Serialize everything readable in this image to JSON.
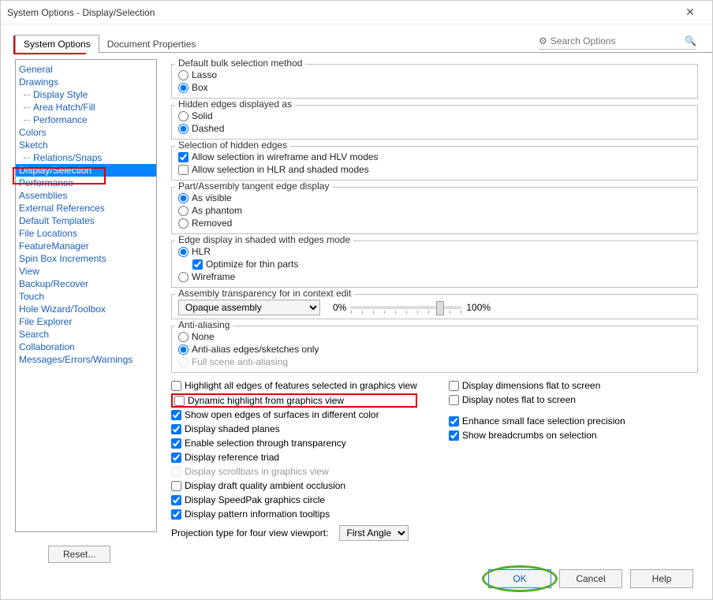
{
  "window": {
    "title": "System Options - Display/Selection"
  },
  "search": {
    "placeholder": "Search Options"
  },
  "tabs": {
    "system": "System Options",
    "document": "Document Properties"
  },
  "tree": [
    "General",
    "Drawings",
    "Display Style",
    "Area Hatch/Fill",
    "Performance",
    "Colors",
    "Sketch",
    "Relations/Snaps",
    "Display/Selection",
    "Performance",
    "Assemblies",
    "External References",
    "Default Templates",
    "File Locations",
    "FeatureManager",
    "Spin Box Increments",
    "View",
    "Backup/Recover",
    "Touch",
    "Hole Wizard/Toolbox",
    "File Explorer",
    "Search",
    "Collaboration",
    "Messages/Errors/Warnings"
  ],
  "tree_meta": {
    "indent_idx": [
      2,
      3,
      4,
      7
    ],
    "selected_idx": 8
  },
  "groups": {
    "bulk": {
      "title": "Default bulk selection method",
      "lasso": "Lasso",
      "box": "Box"
    },
    "hidden": {
      "title": "Hidden edges displayed as",
      "solid": "Solid",
      "dashed": "Dashed"
    },
    "selh": {
      "title": "Selection of hidden edges",
      "wf": "Allow selection in wireframe and HLV modes",
      "hlr": "Allow selection in HLR and shaded modes"
    },
    "tang": {
      "title": "Part/Assembly tangent edge display",
      "vis": "As visible",
      "ph": "As phantom",
      "rm": "Removed"
    },
    "edge": {
      "title": "Edge display in shaded with edges mode",
      "hlr": "HLR",
      "opt": "Optimize for thin parts",
      "wf": "Wireframe"
    },
    "asm": {
      "title": "Assembly transparency for in context edit",
      "sel": "Opaque assembly",
      "lo": "0%",
      "hi": "100%"
    },
    "aa": {
      "title": "Anti-aliasing",
      "none": "None",
      "edges": "Anti-alias edges/sketches only",
      "full": "Full scene anti-aliasing"
    }
  },
  "checks": {
    "hlall": "Highlight all edges of features selected in graphics view",
    "dyn": "Dynamic highlight from graphics view",
    "open": "Show open edges of surfaces in different color",
    "shaded": "Display shaded planes",
    "transel": "Enable selection through transparency",
    "triad": "Display reference triad",
    "scroll": "Display scrollbars in graphics view",
    "draftao": "Display draft quality ambient occlusion",
    "speed": "Display SpeedPak graphics circle",
    "pattern": "Display pattern information tooltips"
  },
  "rchecks": {
    "dims": "Display dimensions flat to screen",
    "notes": "Display notes flat to screen",
    "small": "Enhance small face selection precision",
    "bread": "Show breadcrumbs on selection"
  },
  "proj": {
    "label": "Projection type for four view viewport:",
    "sel": "First Angle"
  },
  "buttons": {
    "reset": "Reset...",
    "ok": "OK",
    "cancel": "Cancel",
    "help": "Help"
  }
}
